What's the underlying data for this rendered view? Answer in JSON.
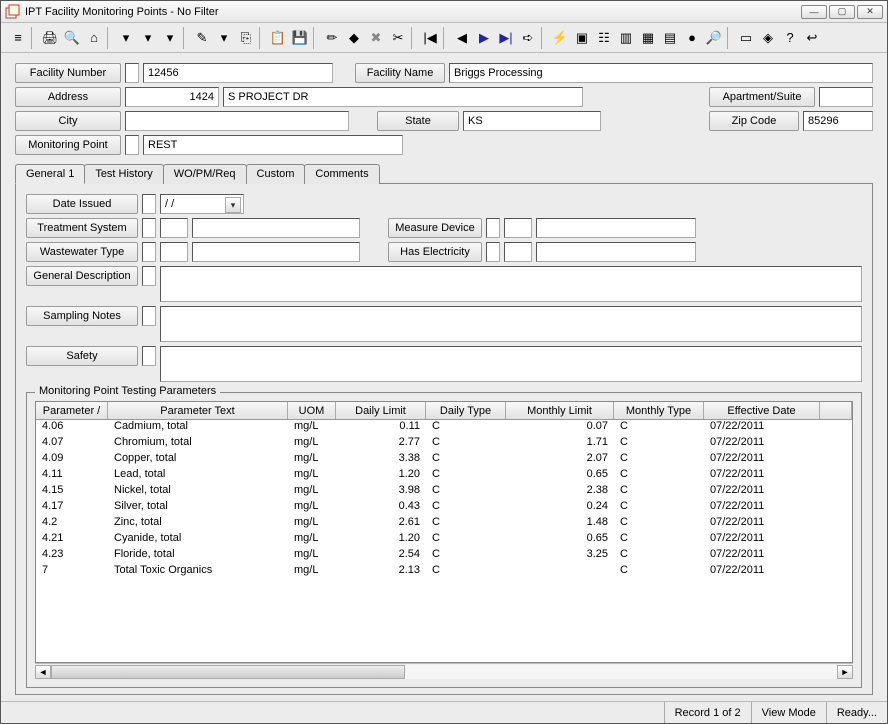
{
  "window": {
    "title": "IPT Facility Monitoring Points - No Filter",
    "record_status": "Record 1 of 2",
    "mode": "View Mode",
    "ready": "Ready..."
  },
  "labels": {
    "facility_number": "Facility Number",
    "facility_name": "Facility Name",
    "address": "Address",
    "apartment_suite": "Apartment/Suite",
    "city": "City",
    "state": "State",
    "zip_code": "Zip Code",
    "monitoring_point": "Monitoring Point",
    "date_issued": "Date Issued",
    "treatment_system": "Treatment System",
    "wastewater_type": "Wastewater Type",
    "measure_device": "Measure Device",
    "has_electricity": "Has Electricity",
    "general_description": "General Description",
    "sampling_notes": "Sampling Notes",
    "safety": "Safety"
  },
  "fields": {
    "facility_number": "12456",
    "facility_name": "Briggs Processing",
    "address_num": "1424",
    "address_street": "S PROJECT DR",
    "apartment_suite": "",
    "city": "",
    "state": "KS",
    "zip_code": "85296",
    "monitoring_point": "REST",
    "date_issued": "  /  /",
    "treatment_system_code": "",
    "treatment_system_text": "",
    "wastewater_type_code": "",
    "wastewater_type_text": "",
    "measure_device_code": "",
    "measure_device_text": "",
    "has_electricity_code": "",
    "has_electricity_text": "",
    "general_description": "",
    "sampling_notes": "",
    "safety": ""
  },
  "tabs": [
    "General 1",
    "Test History",
    "WO/PM/Req",
    "Custom",
    "Comments"
  ],
  "active_tab": 0,
  "grid": {
    "title": "Monitoring Point Testing Parameters",
    "columns": [
      "Parameter /",
      "Parameter Text",
      "UOM",
      "Daily Limit",
      "Daily Type",
      "Monthly Limit",
      "Monthly Type",
      "Effective Date"
    ],
    "rows": [
      {
        "param": "4.06",
        "ptext": "Cadmium, total",
        "uom": "mg/L",
        "dl": "0.11",
        "dt": "C",
        "ml": "0.07",
        "mt": "C",
        "ed": "07/22/2011"
      },
      {
        "param": "4.07",
        "ptext": "Chromium, total",
        "uom": "mg/L",
        "dl": "2.77",
        "dt": "C",
        "ml": "1.71",
        "mt": "C",
        "ed": "07/22/2011"
      },
      {
        "param": "4.09",
        "ptext": "Copper, total",
        "uom": "mg/L",
        "dl": "3.38",
        "dt": "C",
        "ml": "2.07",
        "mt": "C",
        "ed": "07/22/2011"
      },
      {
        "param": "4.11",
        "ptext": "Lead, total",
        "uom": "mg/L",
        "dl": "1.20",
        "dt": "C",
        "ml": "0.65",
        "mt": "C",
        "ed": "07/22/2011"
      },
      {
        "param": "4.15",
        "ptext": "Nickel, total",
        "uom": "mg/L",
        "dl": "3.98",
        "dt": "C",
        "ml": "2.38",
        "mt": "C",
        "ed": "07/22/2011"
      },
      {
        "param": "4.17",
        "ptext": "Silver, total",
        "uom": "mg/L",
        "dl": "0.43",
        "dt": "C",
        "ml": "0.24",
        "mt": "C",
        "ed": "07/22/2011"
      },
      {
        "param": "4.2",
        "ptext": "Zinc, total",
        "uom": "mg/L",
        "dl": "2.61",
        "dt": "C",
        "ml": "1.48",
        "mt": "C",
        "ed": "07/22/2011"
      },
      {
        "param": "4.21",
        "ptext": "Cyanide, total",
        "uom": "mg/L",
        "dl": "1.20",
        "dt": "C",
        "ml": "0.65",
        "mt": "C",
        "ed": "07/22/2011"
      },
      {
        "param": "4.23",
        "ptext": "Floride, total",
        "uom": "mg/L",
        "dl": "2.54",
        "dt": "C",
        "ml": "3.25",
        "mt": "C",
        "ed": "07/22/2011"
      },
      {
        "param": "7",
        "ptext": "Total Toxic Organics",
        "uom": "mg/L",
        "dl": "2.13",
        "dt": "C",
        "ml": "",
        "mt": "C",
        "ed": "07/22/2011"
      }
    ]
  },
  "toolbar_icons": [
    "menu-icon",
    "print-icon",
    "print-preview-icon",
    "home-icon",
    "dropdown-icon",
    "filter-icon",
    "dropdown-icon",
    "new-icon",
    "dropdown-icon",
    "copy-icon",
    "paste-icon",
    "save-icon",
    "edit-icon",
    "note-icon",
    "delete-icon",
    "cut-icon",
    "first-icon",
    "prev-icon",
    "next-icon",
    "last-icon",
    "forward-icon",
    "bolt-icon",
    "form-icon",
    "tree-icon",
    "chart-icon",
    "img-icon",
    "grid-icon",
    "globe-icon",
    "find-icon",
    "calc-icon",
    "book-icon",
    "help-icon",
    "exit-icon"
  ]
}
